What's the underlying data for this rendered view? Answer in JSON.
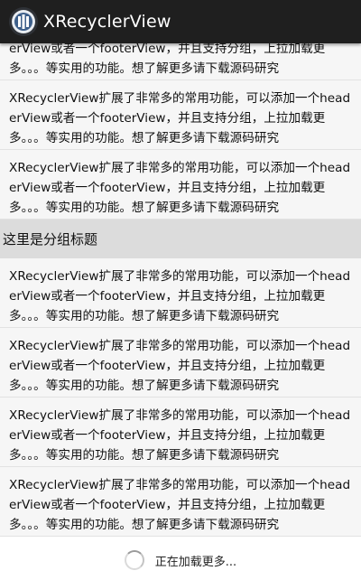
{
  "app": {
    "title": "XRecyclerView"
  },
  "list": {
    "partial_item": {
      "text": "XRecyclerView扩展了非常多的常用功能，可以添加一个headerView或者一个footerView，并且支持分组，上拉加载更多。。。等实用的功能。想了解更多请下载源码研究"
    },
    "items_before": [
      {
        "text": "XRecyclerView扩展了非常多的常用功能，可以添加一个headerView或者一个footerView，并且支持分组，上拉加载更多。。。等实用的功能。想了解更多请下载源码研究"
      },
      {
        "text": "XRecyclerView扩展了非常多的常用功能，可以添加一个headerView或者一个footerView，并且支持分组，上拉加载更多。。。等实用的功能。想了解更多请下载源码研究"
      }
    ],
    "group_title": "这里是分组标题",
    "items_after": [
      {
        "text": "XRecyclerView扩展了非常多的常用功能，可以添加一个headerView或者一个footerView，并且支持分组，上拉加载更多。。。等实用的功能。想了解更多请下载源码研究"
      },
      {
        "text": "XRecyclerView扩展了非常多的常用功能，可以添加一个headerView或者一个footerView，并且支持分组，上拉加载更多。。。等实用的功能。想了解更多请下载源码研究"
      },
      {
        "text": "XRecyclerView扩展了非常多的常用功能，可以添加一个headerView或者一个footerView，并且支持分组，上拉加载更多。。。等实用的功能。想了解更多请下载源码研究"
      },
      {
        "text": "XRecyclerView扩展了非常多的常用功能，可以添加一个headerView或者一个footerView，并且支持分组，上拉加载更多。。。等实用的功能。想了解更多请下载源码研究"
      }
    ],
    "footer": {
      "loading_text": "正在加载更多..."
    }
  },
  "icons": {
    "app_logo": "app-logo-icon",
    "spinner": "loading-spinner-icon"
  }
}
